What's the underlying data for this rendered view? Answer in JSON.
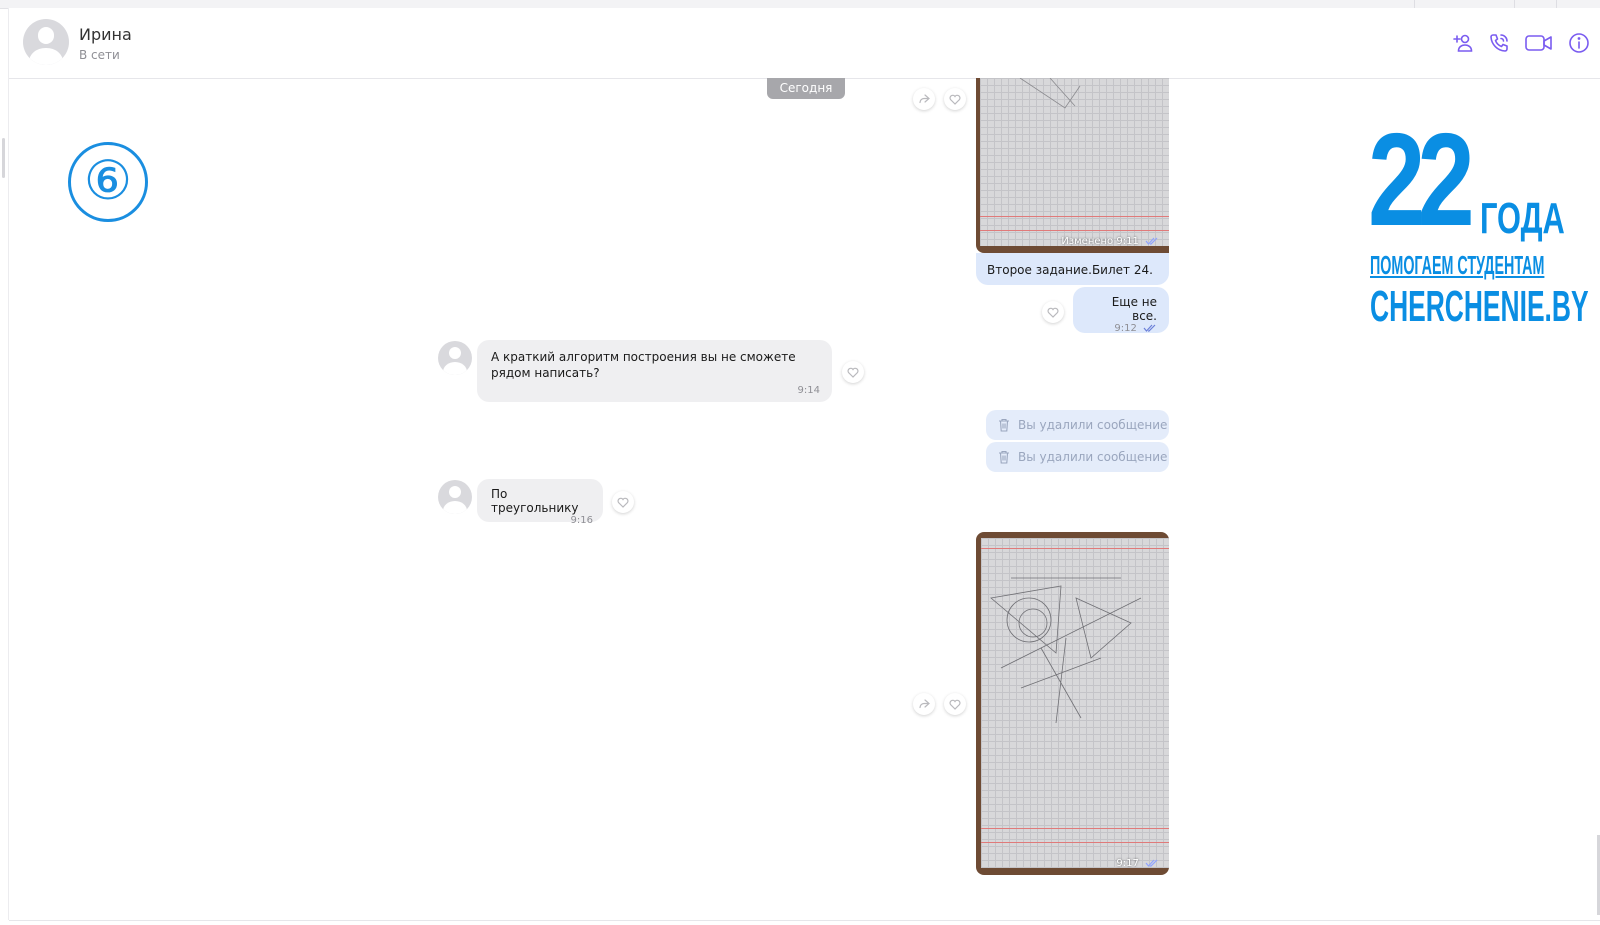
{
  "header": {
    "contact_name": "Ирина",
    "contact_status": "В сети",
    "icons": [
      "add-user-icon",
      "phone-icon",
      "video-icon",
      "info-icon"
    ]
  },
  "chat": {
    "date_separator": "Сегодня",
    "photo1": {
      "meta": "Изменено 9:11"
    },
    "caption": "Второе задание.Билет 24.",
    "msg_out": {
      "text": "Еще не все.",
      "time": "9:12"
    },
    "msg_in1": {
      "text": "А краткий алгоритм построения вы не сможете рядом написать?",
      "time": "9:14"
    },
    "deleted": [
      "Вы удалили сообщение",
      "Вы удалили сообщение"
    ],
    "msg_in2": {
      "text": "По треугольнику",
      "time": "9:16"
    },
    "photo2": {
      "meta": "9:17"
    }
  },
  "overlay": {
    "step_number": "⑥",
    "brand_years": "22",
    "brand_years_word": "ГОДА",
    "brand_tagline": "ПОМОГАЕМ СТУДЕНТАМ",
    "brand_site": "CHERCHENIE.BY"
  },
  "colors": {
    "accent": "#7a5cf0",
    "brand": "#0a8ee3",
    "outgoing": "#dde8fb",
    "incoming": "#efeff1"
  }
}
